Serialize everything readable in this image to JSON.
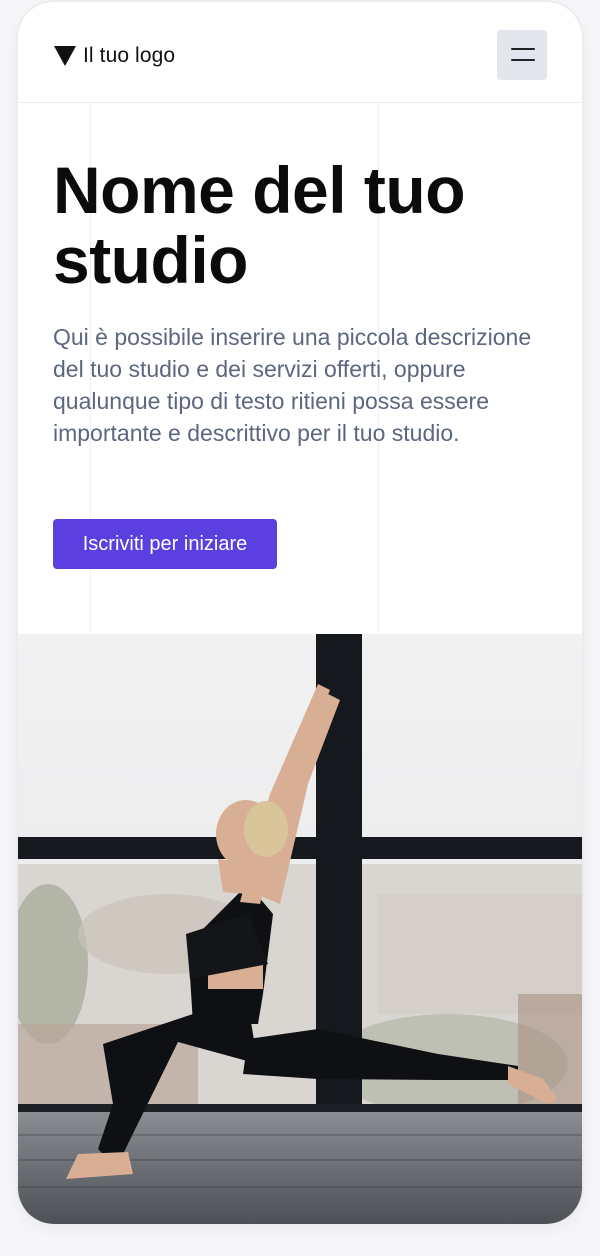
{
  "header": {
    "logo_text": "Il tuo logo",
    "logo_icon": "triangle-down-icon",
    "menu_icon": "hamburger-menu-icon"
  },
  "hero": {
    "title": "Nome del tuo studio",
    "description": "Qui è possibile inserire una piccola descrizione del tuo studio e dei servizi offerti, oppure qualunque tipo di testo ritieni possa essere importante e descrittivo per il tuo studio.",
    "cta_label": "Iscriviti per iniziare"
  },
  "colors": {
    "accent": "#5b3fe0",
    "menu_button_bg": "#e3e7ed",
    "description_text": "#5d6680"
  }
}
